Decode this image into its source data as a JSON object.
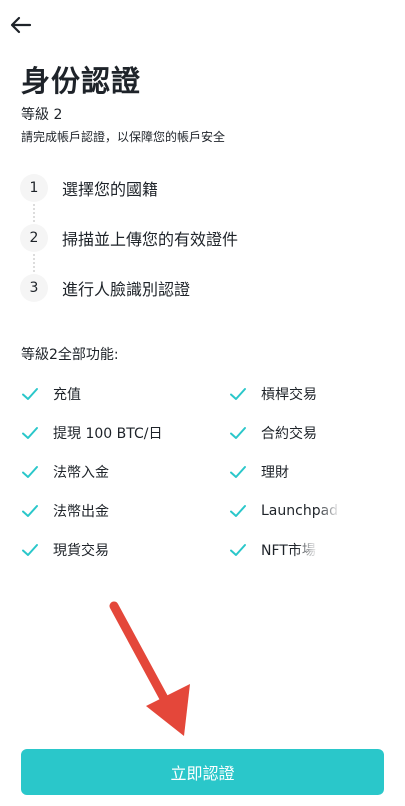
{
  "header": {
    "back_icon": "arrow-left-icon"
  },
  "page": {
    "title": "身份認證",
    "level": "等級 2",
    "description": "請完成帳戶認證，以保障您的帳戶安全"
  },
  "steps": [
    {
      "num": "1",
      "label": "選擇您的國籍"
    },
    {
      "num": "2",
      "label": "掃描並上傳您的有效證件"
    },
    {
      "num": "3",
      "label": "進行人臉識別認證"
    }
  ],
  "features": {
    "title": "等級2全部功能:",
    "items": [
      "充值",
      "槓桿交易",
      "提現 100 BTC/日",
      "合約交易",
      "法幣入金",
      "理財",
      "法幣出金",
      "Launchpad",
      "現貨交易",
      "NFT市場"
    ]
  },
  "cta": {
    "label": "立即認證"
  },
  "colors": {
    "accent": "#2ac7ca",
    "check": "#2ac7ca",
    "annotation_arrow": "#e4473a"
  }
}
